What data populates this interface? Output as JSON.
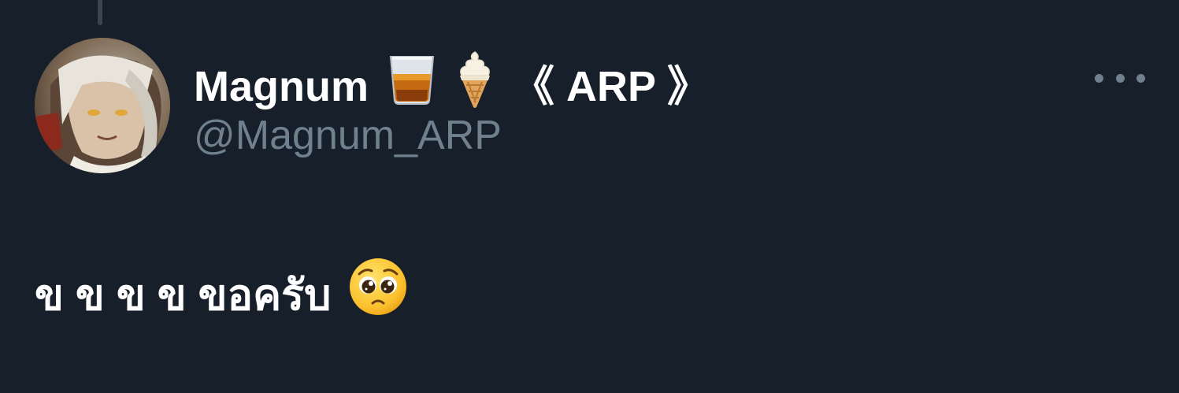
{
  "tweet": {
    "author": {
      "name": "Magnum",
      "name_suffix": "《 ARP 》",
      "name_emojis": [
        "whisky-glass-icon",
        "soft-ice-cream-icon"
      ],
      "handle": "@Magnum_ARP"
    },
    "text": "ข ข ข ข ขอครับ",
    "text_emoji": "pleading-face-icon"
  },
  "colors": {
    "background": "#161f2a",
    "primary_text": "#ffffff",
    "secondary_text": "#71808e",
    "thread_line": "#3a4552"
  }
}
